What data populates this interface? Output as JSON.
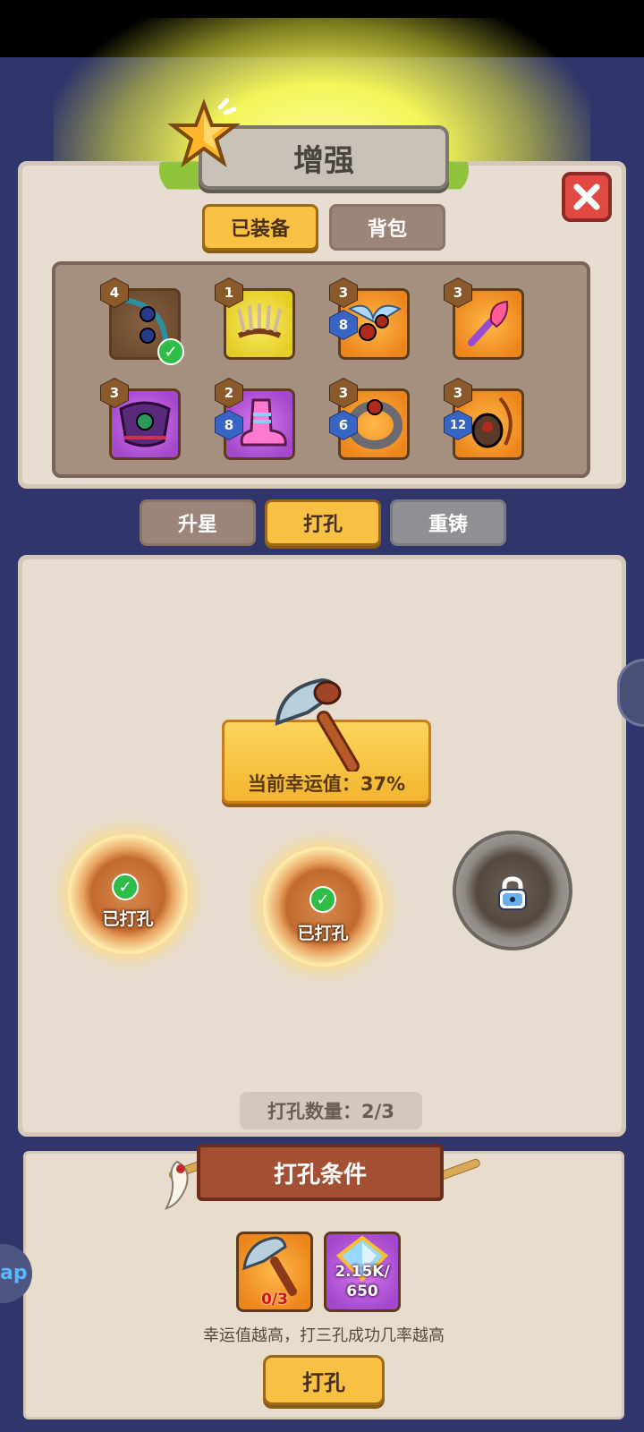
{
  "header": {
    "title": "增强"
  },
  "tabs": {
    "equipped": "已装备",
    "backpack": "背包"
  },
  "items": [
    {
      "rarity": "brown",
      "level": "4",
      "gems": "",
      "equipped_check": true,
      "icon": "bow-icon"
    },
    {
      "rarity": "yellow",
      "level": "1",
      "gems": "",
      "equipped_check": false,
      "icon": "antler-crown-icon"
    },
    {
      "rarity": "orange",
      "level": "3",
      "gems": "8",
      "equipped_check": false,
      "icon": "winged-amulet-icon"
    },
    {
      "rarity": "orange",
      "level": "3",
      "gems": "",
      "equipped_check": false,
      "icon": "flame-wand-icon"
    },
    {
      "rarity": "purple",
      "level": "3",
      "gems": "",
      "equipped_check": false,
      "icon": "armor-icon"
    },
    {
      "rarity": "purple",
      "level": "2",
      "gems": "8",
      "equipped_check": false,
      "icon": "boots-icon"
    },
    {
      "rarity": "orange",
      "level": "3",
      "gems": "6",
      "equipped_check": false,
      "icon": "ring-icon"
    },
    {
      "rarity": "orange",
      "level": "3",
      "gems": "12",
      "equipped_check": false,
      "icon": "pendant-icon"
    }
  ],
  "subtabs": {
    "star_up": "升星",
    "punch": "打孔",
    "reforge": "重铸"
  },
  "luck": {
    "text": "当前幸运值：37%"
  },
  "slots": [
    {
      "status": "done",
      "label": "已打孔"
    },
    {
      "status": "done",
      "label": "已打孔"
    },
    {
      "status": "locked",
      "label": ""
    }
  ],
  "punch_count": "打孔数量：2/3",
  "conditions": {
    "title": "打孔条件",
    "costs": [
      {
        "icon": "pickaxe-icon",
        "amount": "0/3",
        "color": "#c8171b"
      },
      {
        "icon": "crystal-icon",
        "amount": "2.15K/\n650",
        "color": "#ffffff"
      }
    ],
    "hint": "幸运值越高，打三孔成功几率越高",
    "button": "打孔"
  },
  "side_left": {
    "label": "ap"
  },
  "colors": {
    "accent": "#f9c143",
    "danger": "#e14a44",
    "panel": "#e7dcd0"
  }
}
